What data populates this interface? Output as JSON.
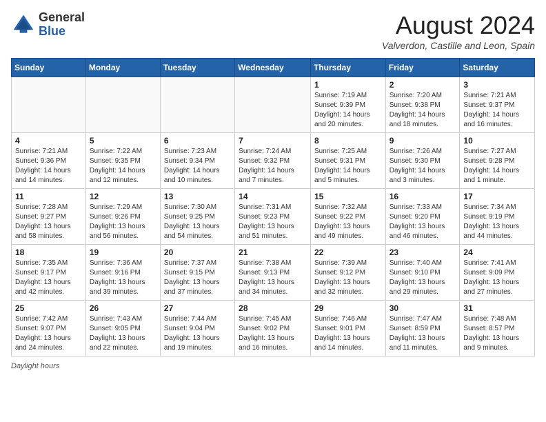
{
  "header": {
    "logo_general": "General",
    "logo_blue": "Blue",
    "month_title": "August 2024",
    "location": "Valverdon, Castille and Leon, Spain"
  },
  "weekdays": [
    "Sunday",
    "Monday",
    "Tuesday",
    "Wednesday",
    "Thursday",
    "Friday",
    "Saturday"
  ],
  "weeks": [
    [
      {
        "day": "",
        "info": ""
      },
      {
        "day": "",
        "info": ""
      },
      {
        "day": "",
        "info": ""
      },
      {
        "day": "",
        "info": ""
      },
      {
        "day": "1",
        "info": "Sunrise: 7:19 AM\nSunset: 9:39 PM\nDaylight: 14 hours and 20 minutes."
      },
      {
        "day": "2",
        "info": "Sunrise: 7:20 AM\nSunset: 9:38 PM\nDaylight: 14 hours and 18 minutes."
      },
      {
        "day": "3",
        "info": "Sunrise: 7:21 AM\nSunset: 9:37 PM\nDaylight: 14 hours and 16 minutes."
      }
    ],
    [
      {
        "day": "4",
        "info": "Sunrise: 7:21 AM\nSunset: 9:36 PM\nDaylight: 14 hours and 14 minutes."
      },
      {
        "day": "5",
        "info": "Sunrise: 7:22 AM\nSunset: 9:35 PM\nDaylight: 14 hours and 12 minutes."
      },
      {
        "day": "6",
        "info": "Sunrise: 7:23 AM\nSunset: 9:34 PM\nDaylight: 14 hours and 10 minutes."
      },
      {
        "day": "7",
        "info": "Sunrise: 7:24 AM\nSunset: 9:32 PM\nDaylight: 14 hours and 7 minutes."
      },
      {
        "day": "8",
        "info": "Sunrise: 7:25 AM\nSunset: 9:31 PM\nDaylight: 14 hours and 5 minutes."
      },
      {
        "day": "9",
        "info": "Sunrise: 7:26 AM\nSunset: 9:30 PM\nDaylight: 14 hours and 3 minutes."
      },
      {
        "day": "10",
        "info": "Sunrise: 7:27 AM\nSunset: 9:28 PM\nDaylight: 14 hours and 1 minute."
      }
    ],
    [
      {
        "day": "11",
        "info": "Sunrise: 7:28 AM\nSunset: 9:27 PM\nDaylight: 13 hours and 58 minutes."
      },
      {
        "day": "12",
        "info": "Sunrise: 7:29 AM\nSunset: 9:26 PM\nDaylight: 13 hours and 56 minutes."
      },
      {
        "day": "13",
        "info": "Sunrise: 7:30 AM\nSunset: 9:25 PM\nDaylight: 13 hours and 54 minutes."
      },
      {
        "day": "14",
        "info": "Sunrise: 7:31 AM\nSunset: 9:23 PM\nDaylight: 13 hours and 51 minutes."
      },
      {
        "day": "15",
        "info": "Sunrise: 7:32 AM\nSunset: 9:22 PM\nDaylight: 13 hours and 49 minutes."
      },
      {
        "day": "16",
        "info": "Sunrise: 7:33 AM\nSunset: 9:20 PM\nDaylight: 13 hours and 46 minutes."
      },
      {
        "day": "17",
        "info": "Sunrise: 7:34 AM\nSunset: 9:19 PM\nDaylight: 13 hours and 44 minutes."
      }
    ],
    [
      {
        "day": "18",
        "info": "Sunrise: 7:35 AM\nSunset: 9:17 PM\nDaylight: 13 hours and 42 minutes."
      },
      {
        "day": "19",
        "info": "Sunrise: 7:36 AM\nSunset: 9:16 PM\nDaylight: 13 hours and 39 minutes."
      },
      {
        "day": "20",
        "info": "Sunrise: 7:37 AM\nSunset: 9:15 PM\nDaylight: 13 hours and 37 minutes."
      },
      {
        "day": "21",
        "info": "Sunrise: 7:38 AM\nSunset: 9:13 PM\nDaylight: 13 hours and 34 minutes."
      },
      {
        "day": "22",
        "info": "Sunrise: 7:39 AM\nSunset: 9:12 PM\nDaylight: 13 hours and 32 minutes."
      },
      {
        "day": "23",
        "info": "Sunrise: 7:40 AM\nSunset: 9:10 PM\nDaylight: 13 hours and 29 minutes."
      },
      {
        "day": "24",
        "info": "Sunrise: 7:41 AM\nSunset: 9:09 PM\nDaylight: 13 hours and 27 minutes."
      }
    ],
    [
      {
        "day": "25",
        "info": "Sunrise: 7:42 AM\nSunset: 9:07 PM\nDaylight: 13 hours and 24 minutes."
      },
      {
        "day": "26",
        "info": "Sunrise: 7:43 AM\nSunset: 9:05 PM\nDaylight: 13 hours and 22 minutes."
      },
      {
        "day": "27",
        "info": "Sunrise: 7:44 AM\nSunset: 9:04 PM\nDaylight: 13 hours and 19 minutes."
      },
      {
        "day": "28",
        "info": "Sunrise: 7:45 AM\nSunset: 9:02 PM\nDaylight: 13 hours and 16 minutes."
      },
      {
        "day": "29",
        "info": "Sunrise: 7:46 AM\nSunset: 9:01 PM\nDaylight: 13 hours and 14 minutes."
      },
      {
        "day": "30",
        "info": "Sunrise: 7:47 AM\nSunset: 8:59 PM\nDaylight: 13 hours and 11 minutes."
      },
      {
        "day": "31",
        "info": "Sunrise: 7:48 AM\nSunset: 8:57 PM\nDaylight: 13 hours and 9 minutes."
      }
    ]
  ],
  "footer": {
    "label": "Daylight hours"
  }
}
